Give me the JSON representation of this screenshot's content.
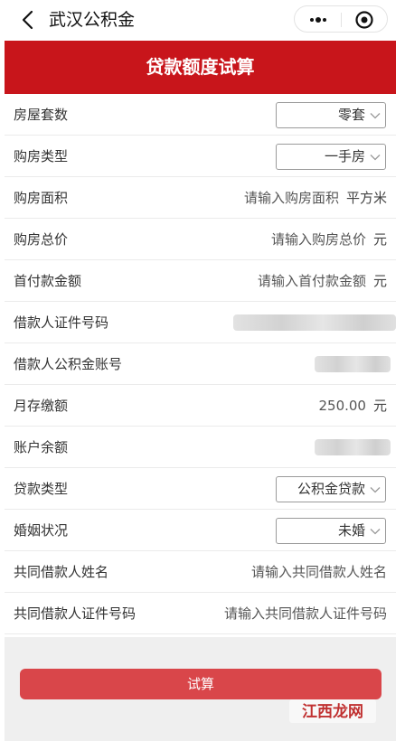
{
  "nav": {
    "title": "武汉公积金"
  },
  "header": {
    "title": "贷款额度试算"
  },
  "form": {
    "house_count": {
      "label": "房屋套数",
      "selected": "零套"
    },
    "house_type": {
      "label": "购房类型",
      "selected": "一手房"
    },
    "area": {
      "label": "购房面积",
      "placeholder": "请输入购房面积",
      "unit": "平方米"
    },
    "total_price": {
      "label": "购房总价",
      "placeholder": "请输入购房总价",
      "unit": "元"
    },
    "down_payment": {
      "label": "首付款金额",
      "placeholder": "请输入首付款金额",
      "unit": "元"
    },
    "borrower_id": {
      "label": "借款人证件号码"
    },
    "borrower_account": {
      "label": "借款人公积金账号"
    },
    "monthly_deposit": {
      "label": "月存缴额",
      "value": "250.00",
      "unit": "元"
    },
    "balance": {
      "label": "账户余额"
    },
    "loan_type": {
      "label": "贷款类型",
      "selected": "公积金贷款"
    },
    "marital": {
      "label": "婚姻状况",
      "selected": "未婚"
    },
    "co_name": {
      "label": "共同借款人姓名",
      "placeholder": "请输入共同借款人姓名"
    },
    "co_id": {
      "label": "共同借款人证件号码",
      "placeholder": "请输入共同借款人证件号码"
    }
  },
  "submit": {
    "label": "试算"
  },
  "watermark": {
    "text": "江西龙网"
  },
  "colors": {
    "brand_red": "#c8151b",
    "button_red": "#d9464a"
  }
}
